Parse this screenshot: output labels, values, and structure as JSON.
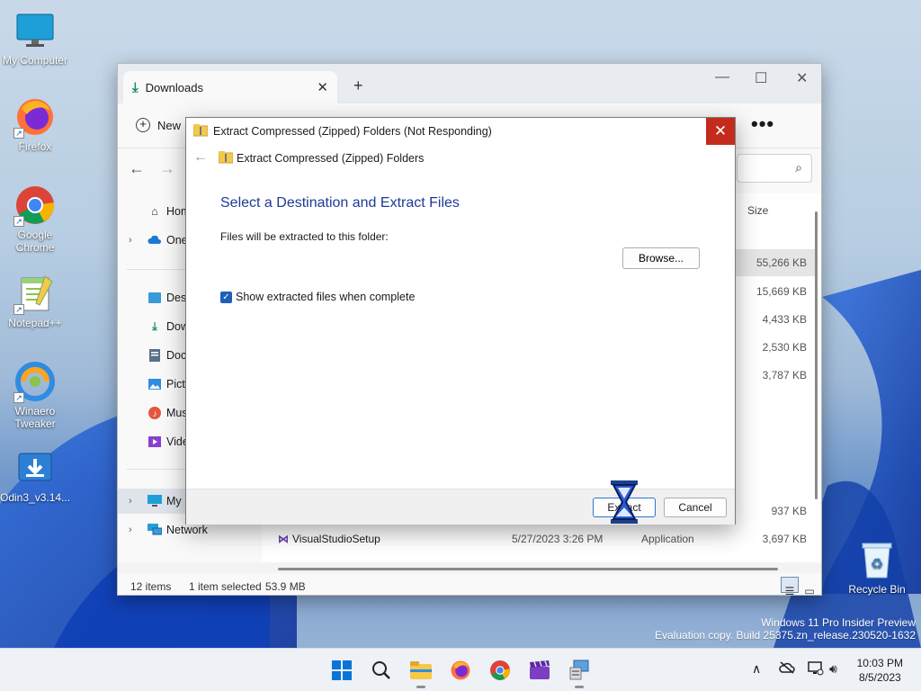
{
  "desktop": {
    "icons": [
      {
        "label": "My Computer"
      },
      {
        "label": "Firefox"
      },
      {
        "label": "Google Chrome"
      },
      {
        "label": "Notepad++"
      },
      {
        "label": "Winaero Tweaker"
      },
      {
        "label": "Odin3_v3.14..."
      },
      {
        "label": "Recycle Bin"
      }
    ],
    "watermark": {
      "line1": "Windows 11 Pro Insider Preview",
      "line2": "Evaluation copy. Build 25375.zn_release.230520-1632"
    }
  },
  "explorer": {
    "tab_title": "Downloads",
    "new_label": "New",
    "more_label": "•••",
    "column_size": "Size",
    "sidebar": [
      {
        "label": "Hom"
      },
      {
        "label": "One"
      },
      {
        "label": "Desl"
      },
      {
        "label": "Dow"
      },
      {
        "label": "Doc"
      },
      {
        "label": "Pict"
      },
      {
        "label": "Mus"
      },
      {
        "label": "Vide"
      },
      {
        "label": "My"
      },
      {
        "label": "Network"
      }
    ],
    "rows": [
      {
        "size": "55,266 KB"
      },
      {
        "size": "15,669 KB"
      },
      {
        "size": "4,433 KB"
      },
      {
        "size": "2,530 KB"
      },
      {
        "size": "3,787 KB"
      },
      {
        "size": "937 KB"
      },
      {
        "name": "VisualStudioSetup",
        "date": "5/27/2023 3:26 PM",
        "type": "Application",
        "size": "3,697 KB"
      }
    ],
    "status": {
      "items": "12 items",
      "selected": "1 item selected",
      "size": "53.9 MB"
    }
  },
  "dialog": {
    "title": "Extract Compressed (Zipped) Folders (Not Responding)",
    "nav_title": "Extract Compressed (Zipped) Folders",
    "heading": "Select a Destination and Extract Files",
    "folder_label": "Files will be extracted to this folder:",
    "browse_label": "Browse...",
    "checkbox_label": "Show extracted files when complete",
    "checkbox_checked": true,
    "extract_label": "Extract",
    "cancel_label": "Cancel"
  },
  "taskbar": {
    "time": "10:03 PM",
    "date": "8/5/2023"
  }
}
